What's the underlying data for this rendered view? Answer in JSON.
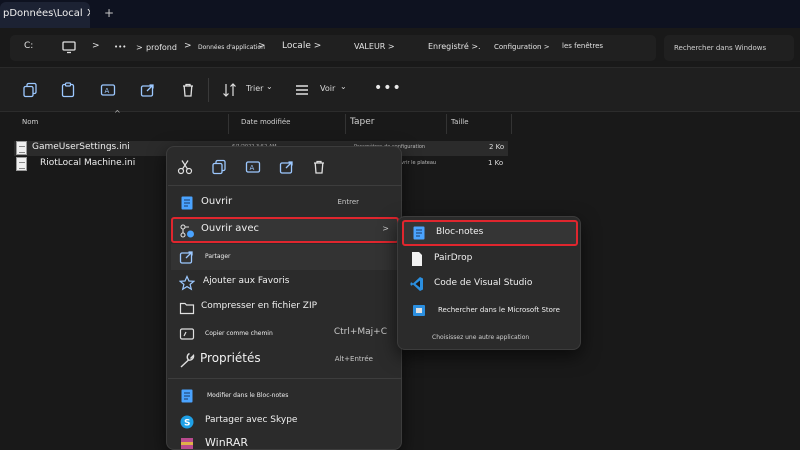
{
  "window": {
    "tab_title": "pDonnées\\Local",
    "tab_close": "X",
    "new_tab": "+"
  },
  "address": {
    "drive": "C:",
    "ellipsis": "•••",
    "separator": ">",
    "crumbs": [
      "profond",
      "Données d'application",
      "Locale >",
      "VALEUR >",
      "Enregistré >.",
      "Configuration >",
      "les fenêtres"
    ],
    "search_placeholder": "Rechercher dans Windows"
  },
  "toolbar": {
    "sort_label": "Trier",
    "view_label": "Voir",
    "more_label": "•••",
    "dropdown_caret": "⌄"
  },
  "columns": {
    "name": "Nom",
    "date": "Date modifiée",
    "type": "Taper",
    "size": "Taille",
    "sort_indicator": "^"
  },
  "files": [
    {
      "name": "GameUserSettings.ini",
      "date": "6/1/2022 3:52 AM",
      "type": "Paramètres de configuration",
      "size": "2 Ko"
    },
    {
      "name": "RiotLocal Machine.ini",
      "date": "",
      "type": "Ouvrir le plateau",
      "size": "1 Ko"
    }
  ],
  "context_menu": {
    "items": [
      {
        "label": "Ouvrir",
        "shortcut": "Entrer"
      },
      {
        "label": "Ouvrir avec",
        "arrow": ">"
      },
      {
        "label": "Partager"
      },
      {
        "label": "Ajouter aux Favoris"
      },
      {
        "label": "Compresser en fichier ZIP"
      },
      {
        "label": "Copier comme chemin",
        "shortcut": "Ctrl+Maj+C"
      },
      {
        "label": "Propriétés",
        "shortcut": "Alt+Entrée"
      },
      {
        "label": "Modifier dans le Bloc-notes"
      },
      {
        "label": "Partager avec Skype"
      },
      {
        "label": "WinRAR"
      }
    ]
  },
  "submenu": {
    "items": [
      {
        "label": "Bloc-notes"
      },
      {
        "label": "PairDrop"
      },
      {
        "label": "Code de Visual Studio"
      },
      {
        "label": "Rechercher dans le Microsoft Store"
      }
    ],
    "footer": "Choisissez une autre application"
  },
  "colors": {
    "highlight_border": "#e0262e",
    "vscode_blue": "#2b8fe0",
    "notepad_blue": "#4aa3ff"
  }
}
